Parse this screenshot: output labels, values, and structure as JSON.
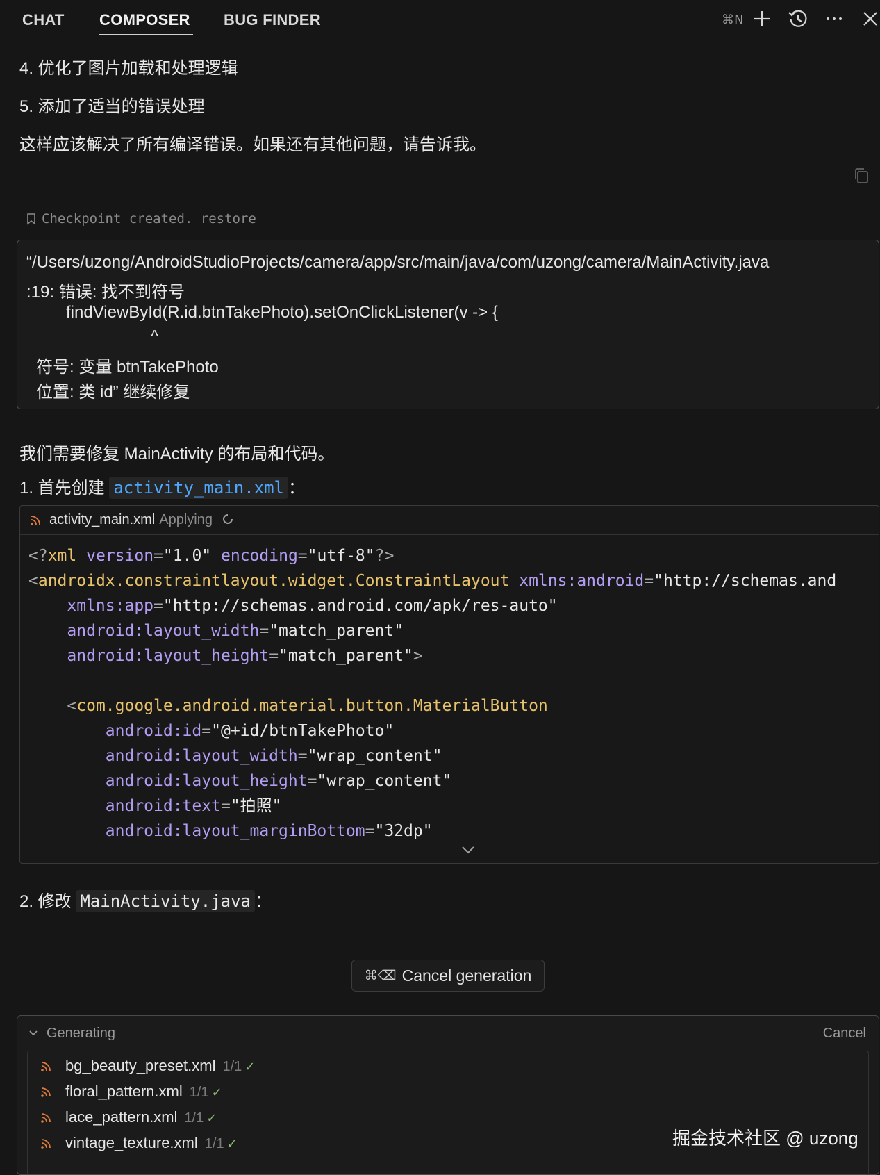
{
  "tabs": [
    "CHAT",
    "COMPOSER",
    "BUG FINDER"
  ],
  "active_tab": "COMPOSER",
  "toolbar": {
    "shortcut": "⌘N",
    "icons": [
      "plus-icon",
      "history-icon",
      "more-icon",
      "close-icon"
    ]
  },
  "assistant_prev": {
    "line4": "4. 优化了图片加载和处理逻辑",
    "line5": "5. 添加了适当的错误处理",
    "summary": "这样应该解决了所有编译错误。如果还有其他问题，请告诉我。"
  },
  "checkpoint": {
    "text": "Checkpoint created.",
    "restore": "restore"
  },
  "user_message": {
    "line1": "“/Users/uzong/AndroidStudioProjects/camera/app/src/main/java/com/uzong/camera/MainActivity.java",
    "line2": ":19: 错误: 找不到符号",
    "line3": "findViewById(R.id.btnTakePhoto).setOnClickListener(v -> {",
    "line4": "^",
    "line5": "符号:   变量 btnTakePhoto",
    "line6": "位置: 类 id”  继续修复"
  },
  "assistant": {
    "intro": "我们需要修复 MainActivity 的布局和代码。",
    "step1_prefix": "1. 首先创建",
    "step1_code": "activity_main.xml",
    "step1_suffix": "：",
    "step2_prefix": "2. 修改",
    "step2_code": "MainActivity.java",
    "step2_suffix": "："
  },
  "code_block": {
    "filename": "activity_main.xml",
    "status": "Applying",
    "lines": [
      [
        [
          "punc",
          "<?"
        ],
        [
          "tag",
          "xml"
        ],
        [
          "str",
          " "
        ],
        [
          "attr",
          "version"
        ],
        [
          "punc",
          "="
        ],
        [
          "str",
          "\"1.0\""
        ],
        [
          "str",
          " "
        ],
        [
          "attr",
          "encoding"
        ],
        [
          "punc",
          "="
        ],
        [
          "str",
          "\"utf-8\""
        ],
        [
          "punc",
          "?>"
        ]
      ],
      [
        [
          "punc",
          "<"
        ],
        [
          "tag",
          "androidx.constraintlayout.widget.ConstraintLayout"
        ],
        [
          "str",
          " "
        ],
        [
          "attr",
          "xmlns:android"
        ],
        [
          "punc",
          "="
        ],
        [
          "str",
          "\"http://schemas.and"
        ]
      ],
      [
        [
          "str",
          "    "
        ],
        [
          "attr",
          "xmlns:app"
        ],
        [
          "punc",
          "="
        ],
        [
          "str",
          "\"http://schemas.android.com/apk/res-auto\""
        ]
      ],
      [
        [
          "str",
          "    "
        ],
        [
          "attr",
          "android:layout_width"
        ],
        [
          "punc",
          "="
        ],
        [
          "str",
          "\"match_parent\""
        ]
      ],
      [
        [
          "str",
          "    "
        ],
        [
          "attr",
          "android:layout_height"
        ],
        [
          "punc",
          "="
        ],
        [
          "str",
          "\"match_parent\""
        ],
        [
          "punc",
          ">"
        ]
      ],
      [
        [
          "str",
          ""
        ]
      ],
      [
        [
          "str",
          "    "
        ],
        [
          "punc",
          "<"
        ],
        [
          "tag",
          "com.google.android.material.button.MaterialButton"
        ]
      ],
      [
        [
          "str",
          "        "
        ],
        [
          "attr",
          "android:id"
        ],
        [
          "punc",
          "="
        ],
        [
          "str",
          "\"@+id/btnTakePhoto\""
        ]
      ],
      [
        [
          "str",
          "        "
        ],
        [
          "attr",
          "android:layout_width"
        ],
        [
          "punc",
          "="
        ],
        [
          "str",
          "\"wrap_content\""
        ]
      ],
      [
        [
          "str",
          "        "
        ],
        [
          "attr",
          "android:layout_height"
        ],
        [
          "punc",
          "="
        ],
        [
          "str",
          "\"wrap_content\""
        ]
      ],
      [
        [
          "str",
          "        "
        ],
        [
          "attr",
          "android:text"
        ],
        [
          "punc",
          "="
        ],
        [
          "str",
          "\"拍照\""
        ]
      ],
      [
        [
          "str",
          "        "
        ],
        [
          "attr",
          "android:layout_marginBottom"
        ],
        [
          "punc",
          "="
        ],
        [
          "str",
          "\"32dp\""
        ]
      ]
    ]
  },
  "cancel_generation": {
    "shortcut": "⌘⌫",
    "label": "Cancel generation"
  },
  "generating": {
    "title": "Generating",
    "cancel": "Cancel",
    "files": [
      {
        "name": "bg_beauty_preset.xml",
        "count": "1/1"
      },
      {
        "name": "floral_pattern.xml",
        "count": "1/1"
      },
      {
        "name": "lace_pattern.xml",
        "count": "1/1"
      },
      {
        "name": "vintage_texture.xml",
        "count": "1/1"
      }
    ]
  },
  "watermark": "掘金技术社区 @ uzong",
  "colors": {
    "background": "#161616",
    "link_blue": "#4ea8ff",
    "xml_tag": "#e8c26a",
    "xml_attr": "#b39df3",
    "rss_orange": "#e07a3a",
    "check_green": "#8ab86f"
  }
}
